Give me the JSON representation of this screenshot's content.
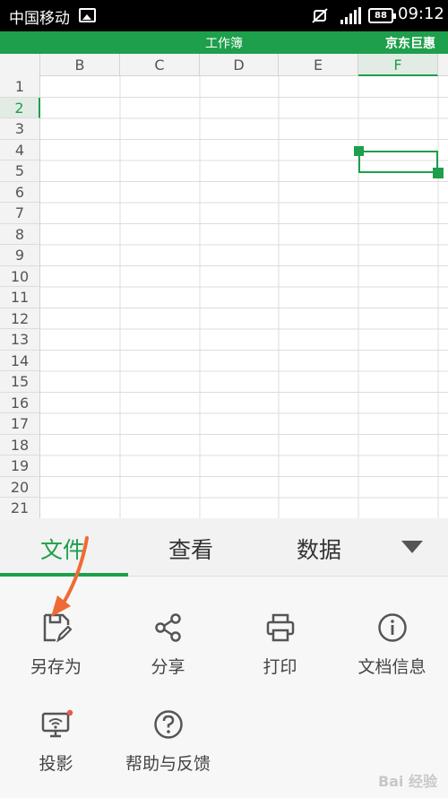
{
  "status_bar": {
    "carrier": "中国移动",
    "battery": "88",
    "time": "09:12",
    "icons": [
      "image-icon",
      "mute-icon",
      "signal-icon",
      "battery-icon"
    ]
  },
  "title_bar": {
    "title": "工作簿",
    "user": "京东巨惠"
  },
  "sheet": {
    "columns": [
      "B",
      "C",
      "D",
      "E",
      "F"
    ],
    "rows": [
      "1",
      "2",
      "3",
      "4",
      "5",
      "6",
      "7",
      "8",
      "9",
      "10",
      "11",
      "12",
      "13",
      "14",
      "15",
      "16",
      "17",
      "18",
      "19",
      "20",
      "21"
    ],
    "selected_cell": "F2",
    "accent": "#1d9f4b"
  },
  "tabs": {
    "items": [
      "文件",
      "查看",
      "数据"
    ],
    "active": "文件",
    "more_icon": "triangle-down-icon"
  },
  "actions": [
    {
      "label": "另存为",
      "icon": "save-as-icon"
    },
    {
      "label": "分享",
      "icon": "share-icon"
    },
    {
      "label": "打印",
      "icon": "print-icon"
    },
    {
      "label": "文档信息",
      "icon": "info-icon"
    },
    {
      "label": "投影",
      "icon": "projection-icon"
    },
    {
      "label": "帮助与反馈",
      "icon": "help-icon"
    }
  ],
  "annotation": {
    "arrow_color": "#f06a35"
  },
  "watermark": "Bai 经验"
}
